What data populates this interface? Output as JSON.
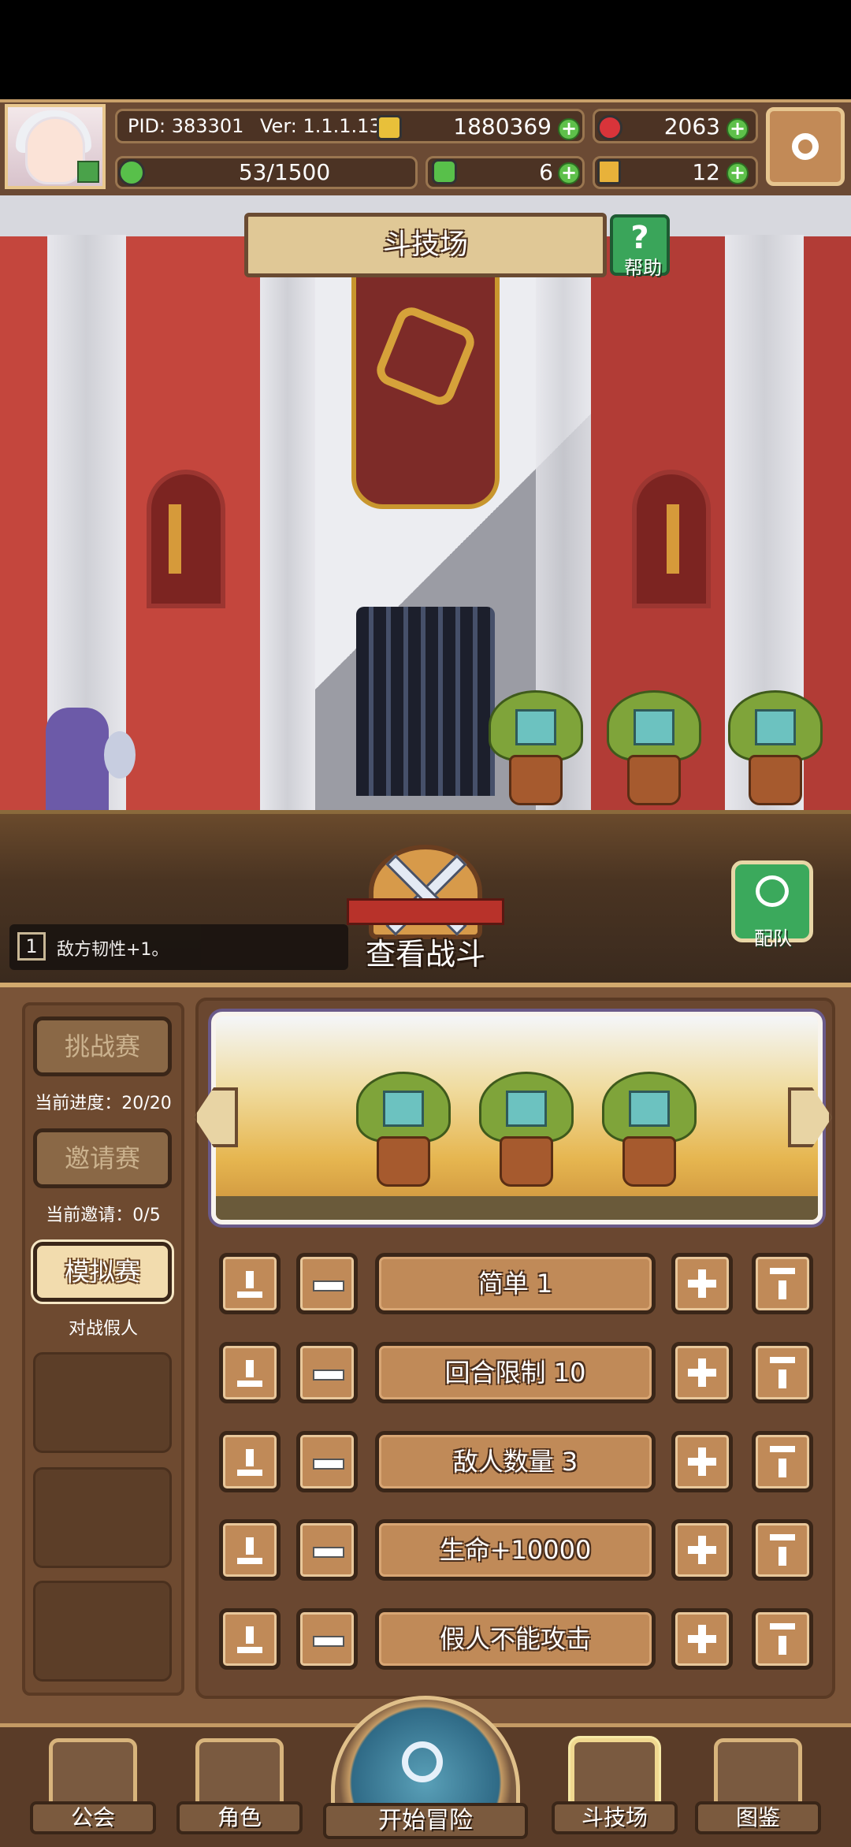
{
  "header": {
    "pid": "PID: 383301",
    "version": "Ver: 1.1.1.13",
    "gold": "1880369",
    "gems": "2063",
    "stamina": "53/1500",
    "clover": "6",
    "ticket": "12",
    "colors": {
      "gold": "#e8c03a",
      "gem": "#d8343a",
      "stamina": "#58c04a",
      "clover": "#58c04a",
      "ticket": "#e8b23a"
    }
  },
  "scene": {
    "title": "斗技场",
    "help_label": "帮助",
    "buff_num": "1",
    "buff_text": "敌方韧性+1。",
    "view_battle": "查看战斗",
    "team_label": "配队"
  },
  "left_tabs": [
    {
      "label": "挑战赛",
      "sub": "当前进度：20/20",
      "active": false
    },
    {
      "label": "邀请赛",
      "sub": "当前邀请：0/5",
      "active": false
    },
    {
      "label": "模拟赛",
      "sub": "对战假人",
      "active": true
    }
  ],
  "options": [
    {
      "label": "简单 1"
    },
    {
      "label": "回合限制 10"
    },
    {
      "label": "敌人数量 3"
    },
    {
      "label": "生命+10000"
    },
    {
      "label": "假人不能攻击"
    }
  ],
  "nav": {
    "guild": "公会",
    "character": "角色",
    "adventure": "开始冒险",
    "arena": "斗技场",
    "codex": "图鉴"
  },
  "icons": [
    "avatar",
    "gold-coin-icon",
    "red-gem-icon",
    "stamina-icon",
    "clover-icon",
    "ticket-icon",
    "settings-gear-icon",
    "help-icon",
    "crossed-swords-icon",
    "team-icon",
    "prev-arrow-icon",
    "next-arrow-icon",
    "min-icon",
    "minus-icon",
    "plus-icon",
    "max-icon",
    "magnifier-icon"
  ]
}
